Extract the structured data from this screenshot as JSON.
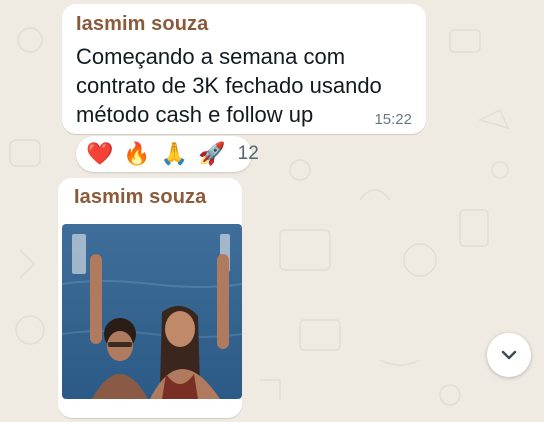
{
  "messages": [
    {
      "sender": "Iasmim souza",
      "text": "Começando a semana com contrato de 3K fechado usando método cash e follow up",
      "time": "15:22",
      "reactions": {
        "emojis": [
          "❤️",
          "🔥",
          "🙏",
          "🚀"
        ],
        "count": "12"
      }
    },
    {
      "sender": "Iasmim souza",
      "attachment": "photo"
    }
  ],
  "scroll_button": {
    "icon": "chevron-down-icon"
  },
  "colors": {
    "background": "#efeae2",
    "bubble": "#ffffff",
    "sender": "#8a5a3b",
    "time": "#667781"
  }
}
